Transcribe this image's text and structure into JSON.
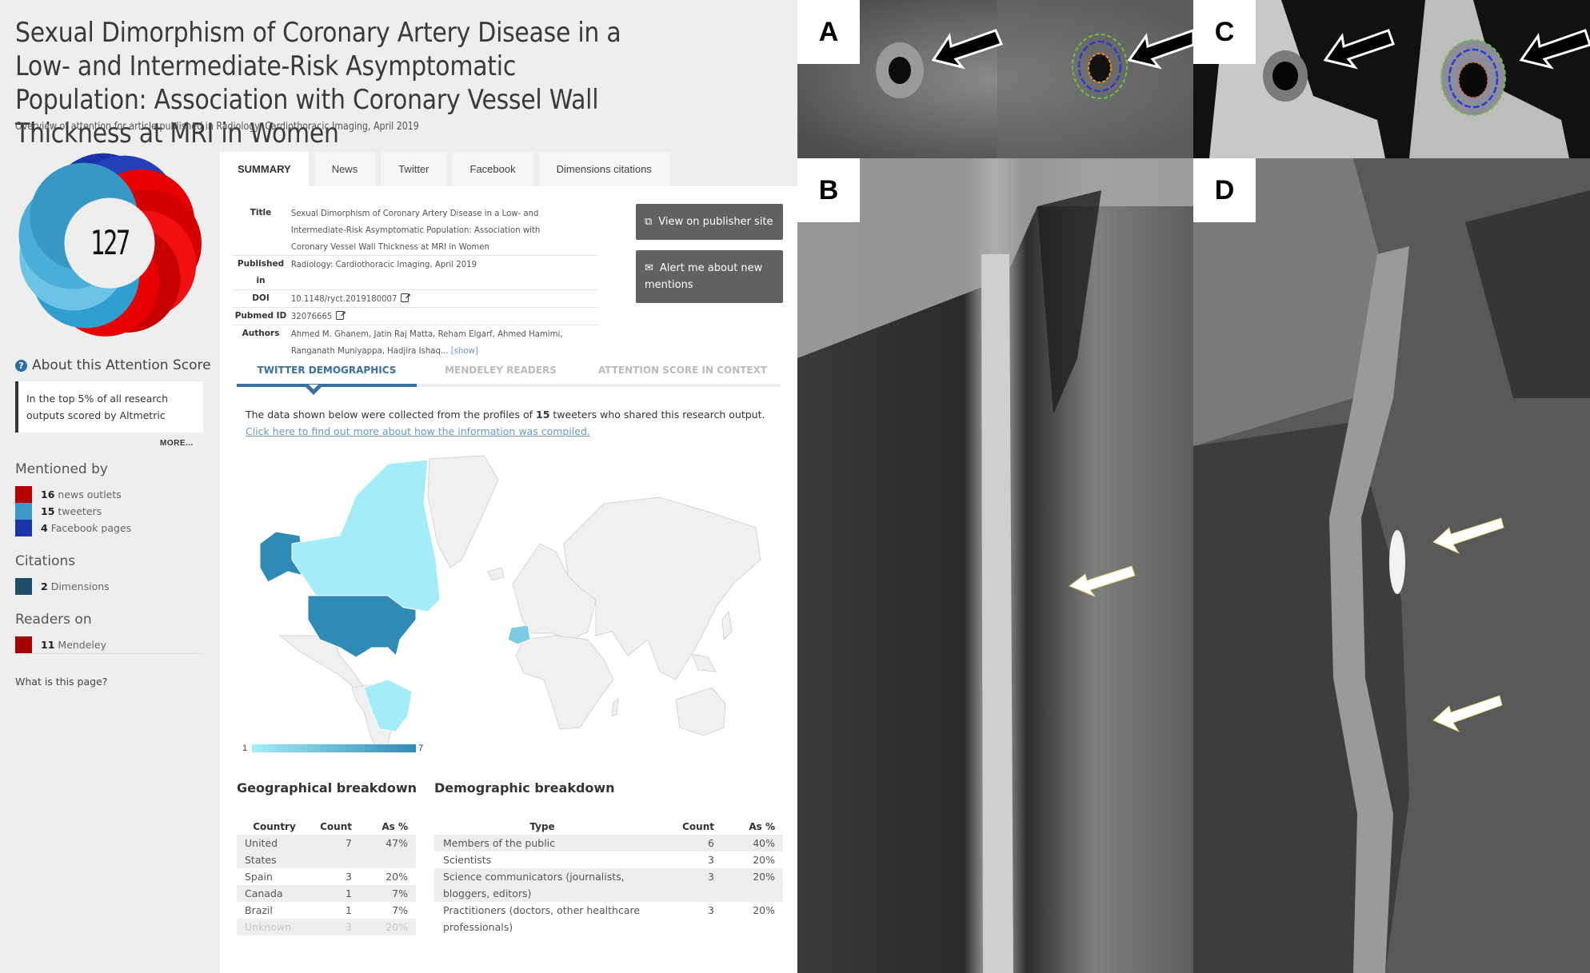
{
  "page": {
    "title": "Sexual Dimorphism of Coronary Artery Disease in a Low- and Intermediate-Risk Asymptomatic Population: Association with Coronary Vessel Wall Thickness at MRI in Women",
    "subtitle": "Overview of attention for article published in Radiology: Cardiothoracic Imaging, April 2019"
  },
  "sidebar": {
    "score": "127",
    "donut_colors": {
      "news": "#e60000",
      "twitter": "#2f9fd0",
      "facebook": "#1b33a8"
    },
    "about_label": "About this Attention Score",
    "top_text": "In the top 5% of all research outputs scored by Altmetric",
    "more_label": "MORE...",
    "mentioned_heading": "Mentioned by",
    "mentioned": [
      {
        "count": "16",
        "label": "news outlets",
        "color": "#b30000"
      },
      {
        "count": "15",
        "label": "tweeters",
        "color": "#3b9ac7"
      },
      {
        "count": "4",
        "label": "Facebook pages",
        "color": "#1c35a6"
      }
    ],
    "citations_heading": "Citations",
    "citations": [
      {
        "count": "2",
        "label": "Dimensions",
        "color": "#1e4d6b"
      }
    ],
    "readers_heading": "Readers on",
    "readers": [
      {
        "count": "11",
        "label": "Mendeley",
        "color": "#a80000"
      }
    ],
    "what_link": "What is this page?"
  },
  "tabs": [
    {
      "label": "SUMMARY",
      "active": true
    },
    {
      "label": "News",
      "active": false
    },
    {
      "label": "Twitter",
      "active": false
    },
    {
      "label": "Facebook",
      "active": false
    },
    {
      "label": "Dimensions citations",
      "active": false
    }
  ],
  "summary": {
    "rows": [
      {
        "key": "Title",
        "value": "Sexual Dimorphism of Coronary Artery Disease in a Low- and Intermediate-Risk Asymptomatic Population: Association with Coronary Vessel Wall Thickness at MRI in Women"
      },
      {
        "key": "Published in",
        "value": "Radiology: Cardiothoracic Imaging, April 2019"
      },
      {
        "key": "DOI",
        "value": "10.1148/ryct.2019180007"
      },
      {
        "key": "Pubmed ID",
        "value": "32076665"
      },
      {
        "key": "Authors",
        "value": "Ahmed M. Ghanem, Jatin Raj Matta, Reham Elgarf, Ahmed Hamimi, Ranganath Muniyappa, Hadjira Ishaq..."
      }
    ],
    "show_link": "[show]",
    "view_button": "View on publisher site",
    "alert_button": "Alert me about new mentions"
  },
  "subtabs": [
    {
      "label": "TWITTER DEMOGRAPHICS",
      "active": true
    },
    {
      "label": "MENDELEY READERS",
      "active": false
    },
    {
      "label": "ATTENTION SCORE IN CONTEXT",
      "active": false
    }
  ],
  "demographics": {
    "intro_before": "The data shown below were collected from the profiles of ",
    "intro_count": "15",
    "intro_after": " tweeters who shared this research output. ",
    "intro_link": "Click here to find out more about how the information was compiled.",
    "scale_min": "1",
    "scale_max": "7",
    "scale_colors": [
      "#a3ecf8",
      "#2f8ab6"
    ],
    "map_countries": [
      {
        "name": "United States",
        "count": 7
      },
      {
        "name": "Spain",
        "count": 3
      },
      {
        "name": "Canada",
        "count": 1
      },
      {
        "name": "Brazil",
        "count": 1
      }
    ],
    "geo_heading": "Geographical breakdown",
    "geo_columns": [
      "Country",
      "Count",
      "As %"
    ],
    "geo_rows": [
      {
        "country": "United States",
        "count": "7",
        "pct": "47%"
      },
      {
        "country": "Spain",
        "count": "3",
        "pct": "20%"
      },
      {
        "country": "Canada",
        "count": "1",
        "pct": "7%"
      },
      {
        "country": "Brazil",
        "count": "1",
        "pct": "7%"
      },
      {
        "country": "Unknown",
        "count": "3",
        "pct": "20%"
      }
    ],
    "demo_heading": "Demographic breakdown",
    "demo_columns": [
      "Type",
      "Count",
      "As %"
    ],
    "demo_rows": [
      {
        "type": "Members of the public",
        "count": "6",
        "pct": "40%"
      },
      {
        "type": "Scientists",
        "count": "3",
        "pct": "20%"
      },
      {
        "type": "Science communicators (journalists, bloggers, editors)",
        "count": "3",
        "pct": "20%"
      },
      {
        "type": "Practitioners (doctors, other healthcare professionals)",
        "count": "3",
        "pct": "20%"
      }
    ]
  },
  "figure": {
    "panels": [
      {
        "label": "A"
      },
      {
        "label": "B"
      },
      {
        "label": "C"
      },
      {
        "label": "D"
      }
    ]
  }
}
